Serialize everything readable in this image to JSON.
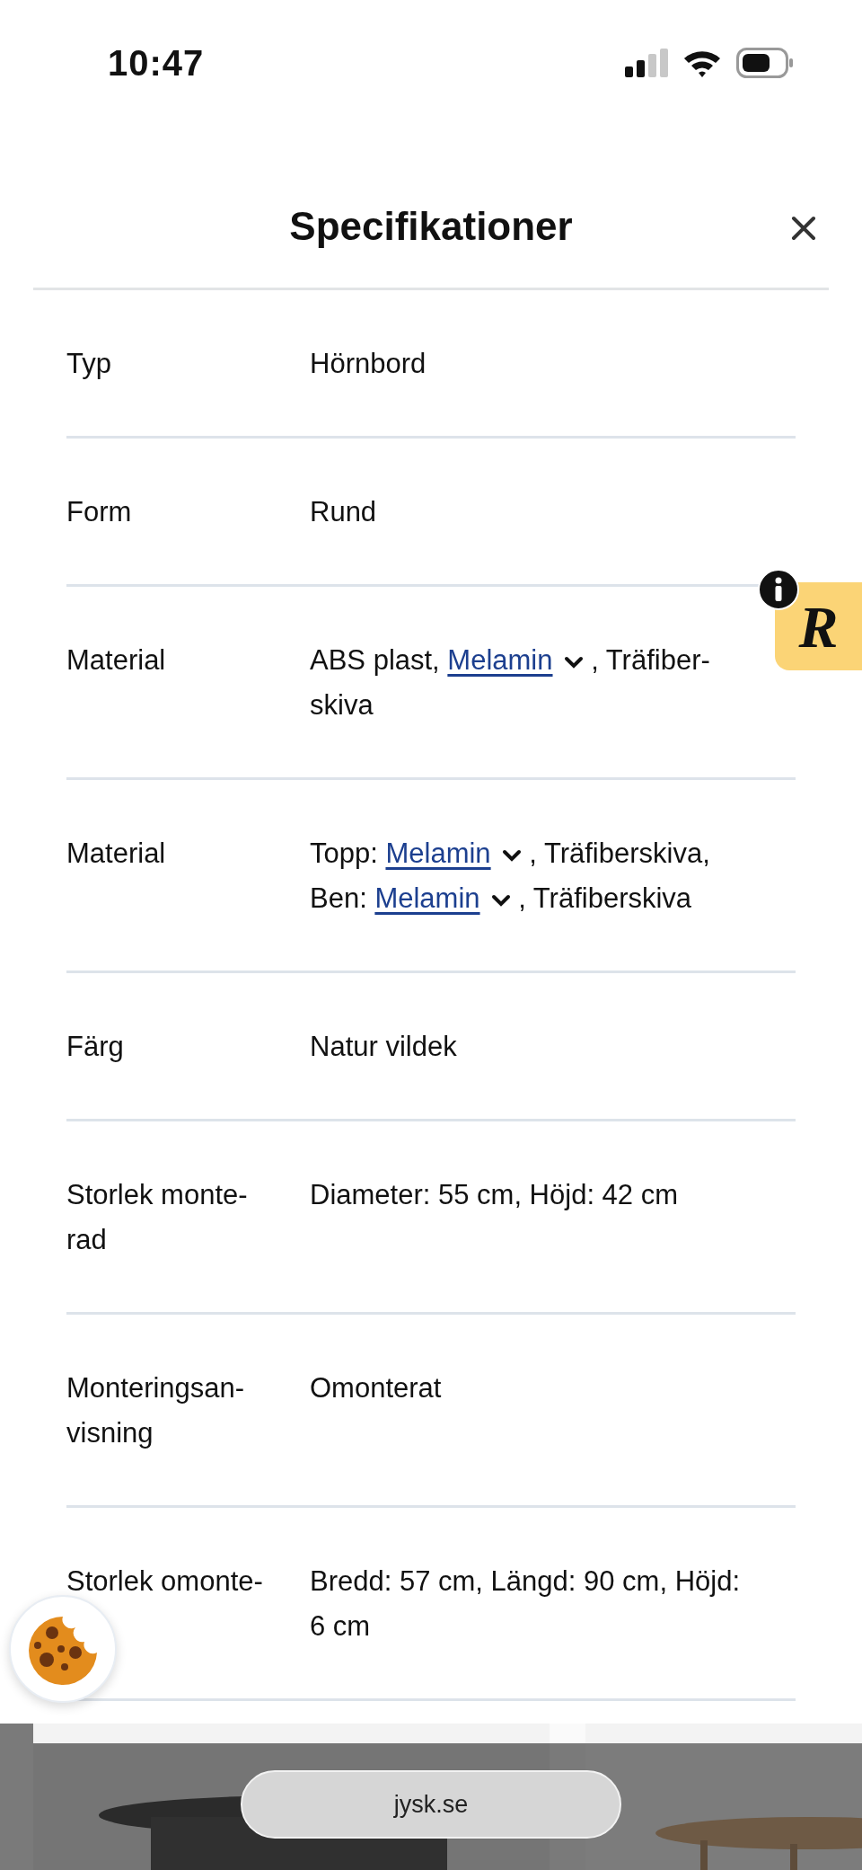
{
  "status_bar": {
    "time": "10:47"
  },
  "header": {
    "title": "Specifikationer"
  },
  "rows": [
    {
      "label": [
        "Typ"
      ],
      "value": [
        [
          {
            "kind": "text",
            "text": "Hörnbord"
          }
        ]
      ]
    },
    {
      "label": [
        "Form"
      ],
      "value": [
        [
          {
            "kind": "text",
            "text": "Rund"
          }
        ]
      ]
    },
    {
      "label": [
        "Material"
      ],
      "value": [
        [
          {
            "kind": "text",
            "text": "ABS plast, "
          },
          {
            "kind": "link",
            "text": "Melamin"
          },
          {
            "kind": "text",
            "text": " , Träfiber-"
          }
        ],
        [
          {
            "kind": "text",
            "text": "skiva"
          }
        ]
      ]
    },
    {
      "label": [
        "Material"
      ],
      "value": [
        [
          {
            "kind": "text",
            "text": "Topp: "
          },
          {
            "kind": "link",
            "text": "Melamin"
          },
          {
            "kind": "text",
            "text": " , Träfiberskiva,"
          }
        ],
        [
          {
            "kind": "text",
            "text": "Ben: "
          },
          {
            "kind": "link",
            "text": "Melamin"
          },
          {
            "kind": "text",
            "text": " , Träfiberskiva"
          }
        ]
      ]
    },
    {
      "label": [
        "Färg"
      ],
      "value": [
        [
          {
            "kind": "text",
            "text": "Natur vildek"
          }
        ]
      ]
    },
    {
      "label": [
        "Storlek monte-",
        "rad"
      ],
      "value": [
        [
          {
            "kind": "text",
            "text": "Diameter: 55 cm, Höjd: 42 cm"
          }
        ]
      ]
    },
    {
      "label": [
        "Monteringsan-",
        "visning"
      ],
      "value": [
        [
          {
            "kind": "text",
            "text": "Omonterat"
          }
        ]
      ]
    },
    {
      "label": [
        "Storlek omonte-"
      ],
      "value": [
        [
          {
            "kind": "text",
            "text": "Bredd: 57 cm, Längd: 90 cm, Höjd:"
          }
        ],
        [
          {
            "kind": "text",
            "text": "6 cm"
          }
        ]
      ]
    }
  ],
  "review_badge": {
    "text": "R"
  },
  "browser_bar": {
    "url": "jysk.se"
  }
}
